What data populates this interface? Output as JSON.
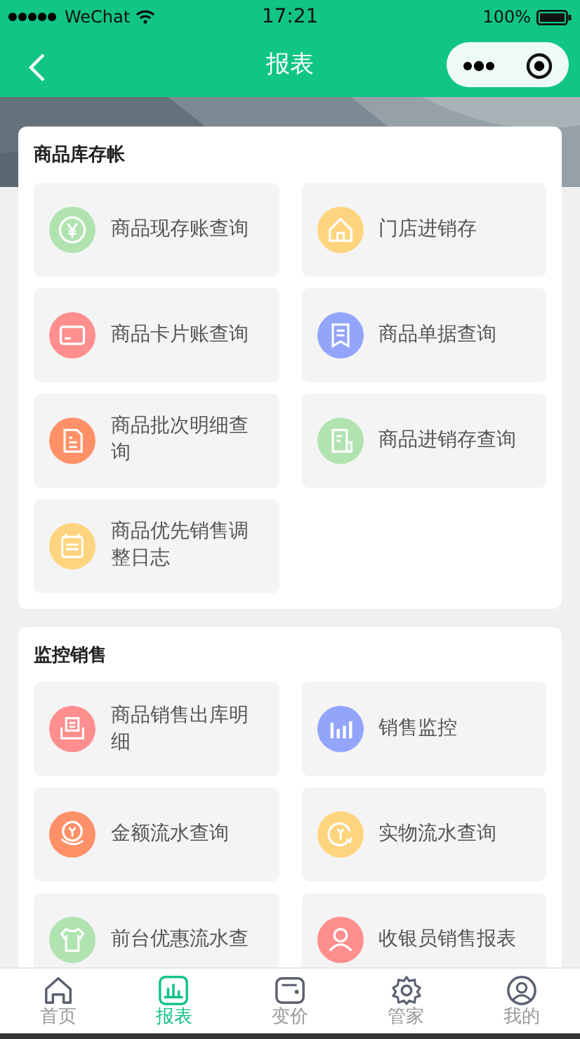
{
  "status_bar": {
    "carrier": "WeChat",
    "time": "17:21",
    "battery": "100%"
  },
  "nav": {
    "title": "报表"
  },
  "sections": [
    {
      "title": "商品库存帐",
      "items": [
        {
          "label": "商品现存账查询",
          "kind": "yen",
          "color": "#b1e3b0"
        },
        {
          "label": "门店进销存",
          "kind": "house",
          "color": "#ffd47f"
        },
        {
          "label": "商品卡片账查询",
          "kind": "card",
          "color": "#ff8e8e"
        },
        {
          "label": "商品单据查询",
          "kind": "receipt",
          "color": "#93a5fb"
        },
        {
          "label": "商品批次明细查询",
          "kind": "doc",
          "color": "#ff9068"
        },
        {
          "label": "商品进销存查询",
          "kind": "note",
          "color": "#b1e3b0"
        },
        {
          "label": "商品优先销售调整日志",
          "kind": "list",
          "color": "#ffd47f"
        }
      ]
    },
    {
      "title": "监控销售",
      "items": [
        {
          "label": "商品销售出库明细",
          "kind": "tray",
          "color": "#ff8e8e"
        },
        {
          "label": "销售监控",
          "kind": "bars",
          "color": "#93a5fb"
        },
        {
          "label": "金额流水查询",
          "kind": "coin",
          "color": "#ff9068"
        },
        {
          "label": "实物流水查询",
          "kind": "cycle",
          "color": "#ffd47f"
        },
        {
          "label": "前台优惠流水查",
          "kind": "shirt",
          "color": "#b1e3b0"
        },
        {
          "label": "收银员销售报表",
          "kind": "person",
          "color": "#ff8e8e"
        }
      ]
    }
  ],
  "tab_bar": [
    {
      "label": "首页",
      "kind": "home",
      "selected": false
    },
    {
      "label": "报表",
      "kind": "chart",
      "selected": true
    },
    {
      "label": "变价",
      "kind": "wallet",
      "selected": false
    },
    {
      "label": "管家",
      "kind": "gear",
      "selected": false
    },
    {
      "label": "我的",
      "kind": "user",
      "selected": false
    }
  ]
}
